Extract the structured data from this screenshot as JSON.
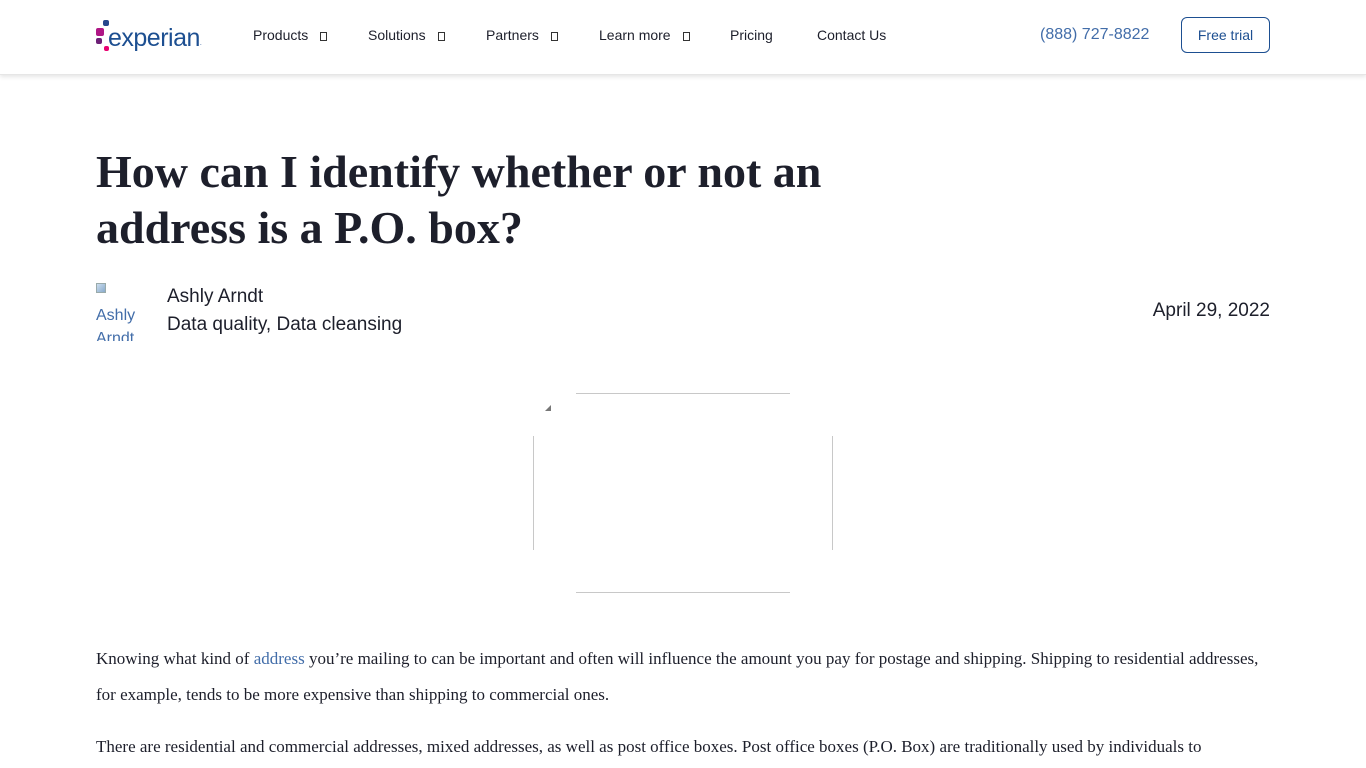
{
  "brand": {
    "name": "experian",
    "mark": ".",
    "colors": {
      "primary_blue": "#1d4f91",
      "link_blue": "#426da9",
      "magenta": "#af1685",
      "purple": "#6d2077",
      "pink": "#e80070",
      "blue": "#26478d"
    }
  },
  "nav": {
    "items": [
      {
        "label": "Products",
        "has_dropdown": true,
        "icon": "chevron-down-icon"
      },
      {
        "label": "Solutions",
        "has_dropdown": true,
        "icon": "chevron-down-icon"
      },
      {
        "label": "Partners",
        "has_dropdown": true,
        "icon": "chevron-down-icon"
      },
      {
        "label": "Learn more",
        "has_dropdown": true,
        "icon": "chevron-down-icon"
      },
      {
        "label": "Pricing",
        "has_dropdown": false
      },
      {
        "label": "Contact Us",
        "has_dropdown": false
      }
    ],
    "phone": "(888) 727-8822",
    "cta_label": "Free trial"
  },
  "article": {
    "title": "How can I identify whether or not an address is a P.O. box?",
    "avatar_alt_line1": "Ashly",
    "avatar_alt_line2": "Arndt",
    "author": "Ashly Arndt",
    "tags": "Data quality, Data cleansing",
    "date": "April 29, 2022",
    "paragraph1": {
      "before_link": "Knowing what kind of ",
      "link_text": "address",
      "after_link": " you’re mailing to can be important and often will influence the amount you pay for postage and shipping. Shipping to residential addresses, for example, tends to be more expensive than shipping to commercial ones."
    },
    "paragraph2": "There are residential and commercial addresses, mixed addresses, as well as post office boxes. Post office boxes (P.O. Box) are traditionally used by individuals to"
  }
}
